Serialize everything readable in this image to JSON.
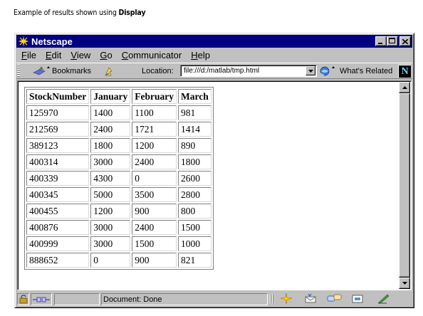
{
  "caption": {
    "prefix": "Example of results shown using",
    "emphasis": "Display"
  },
  "window": {
    "title": "Netscape",
    "controls": [
      "minimize",
      "maximize",
      "close"
    ]
  },
  "menu": {
    "items": [
      {
        "accel": "F",
        "rest": "ile"
      },
      {
        "accel": "E",
        "rest": "dit"
      },
      {
        "accel": "V",
        "rest": "iew"
      },
      {
        "accel": "G",
        "rest": "o"
      },
      {
        "accel": "C",
        "rest": "ommunicator"
      },
      {
        "accel": "H",
        "rest": "elp"
      }
    ]
  },
  "toolbar": {
    "bookmarks_label": "Bookmarks",
    "location_label": "Location:",
    "location_value": "file:///d:/matlab/tmp.html",
    "related_label": "What's Related",
    "logo_letter": "N"
  },
  "table": {
    "headers": [
      "StockNumber",
      "January",
      "February",
      "March"
    ],
    "rows": [
      [
        "125970",
        "1400",
        "1100",
        "981"
      ],
      [
        "212569",
        "2400",
        "1721",
        "1414"
      ],
      [
        "389123",
        "1800",
        "1200",
        "890"
      ],
      [
        "400314",
        "3000",
        "2400",
        "1800"
      ],
      [
        "400339",
        "4300",
        "0",
        "2600"
      ],
      [
        "400345",
        "5000",
        "3500",
        "2800"
      ],
      [
        "400455",
        "1200",
        "900",
        "800"
      ],
      [
        "400876",
        "3000",
        "2400",
        "1500"
      ],
      [
        "400999",
        "3000",
        "1500",
        "1000"
      ],
      [
        "888652",
        "0",
        "900",
        "821"
      ]
    ]
  },
  "status": {
    "text": "Document: Done"
  },
  "colors": {
    "titlebar": "#000080",
    "chrome": "#c0c0c0",
    "content": "#ffffff"
  }
}
